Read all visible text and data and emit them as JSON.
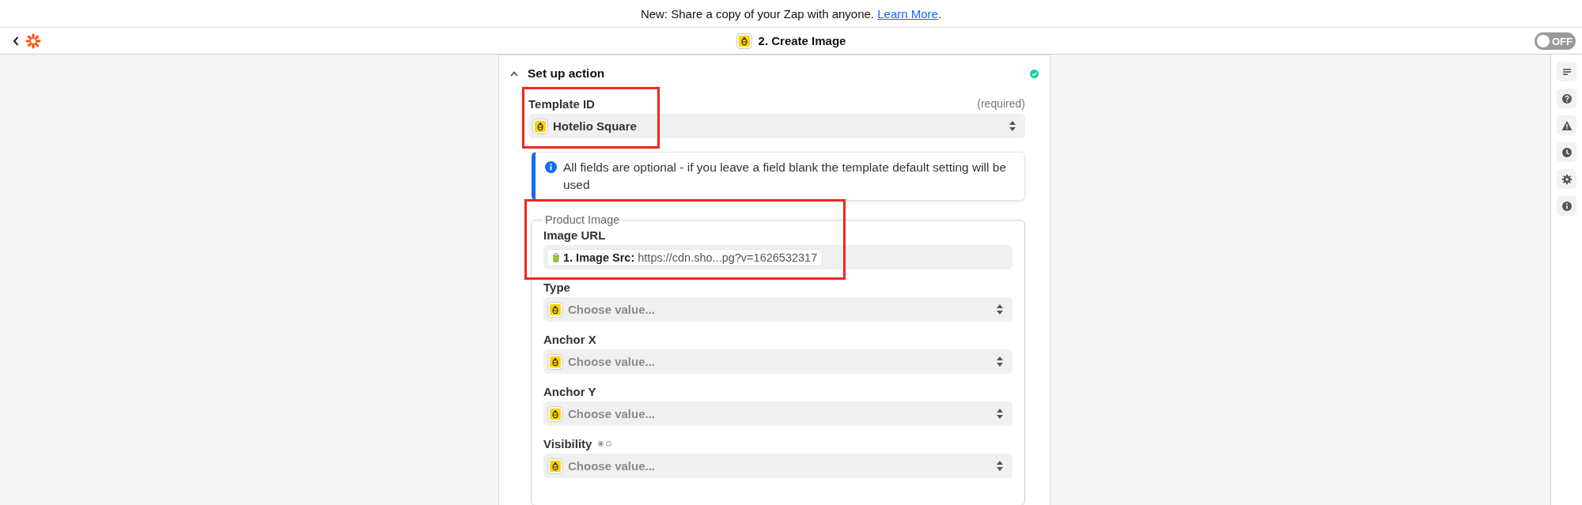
{
  "banner": {
    "text": "New: Share a copy of your Zap with anyone.",
    "link": "Learn More",
    "trail": "."
  },
  "header": {
    "title": "2. Create Image",
    "toggle": {
      "on": false,
      "label": "OFF"
    }
  },
  "section": {
    "title": "Set up action",
    "expanded": true,
    "complete": true
  },
  "template_field": {
    "label": "Template ID",
    "required_note": "(required)",
    "value": "Hotelio Square",
    "highlighted": true
  },
  "notice": {
    "text": "All fields are optional - if you leave a field blank the template default setting will be used"
  },
  "group": {
    "legend": "Product Image",
    "fields": [
      {
        "kind": "mapped",
        "label": "Image URL",
        "highlighted": true,
        "token_label": "1. Image Src:",
        "token_value": "https://cdn.sho...pg?v=1626532317"
      },
      {
        "kind": "select",
        "label": "Type",
        "placeholder": "Choose value..."
      },
      {
        "kind": "select",
        "label": "Anchor X",
        "placeholder": "Choose value..."
      },
      {
        "kind": "select",
        "label": "Anchor Y",
        "placeholder": "Choose value..."
      },
      {
        "kind": "select",
        "label": "Visibility",
        "placeholder": "Choose value...",
        "mode_options": [
          {
            "selected": true
          },
          {
            "selected": false
          }
        ]
      }
    ]
  }
}
